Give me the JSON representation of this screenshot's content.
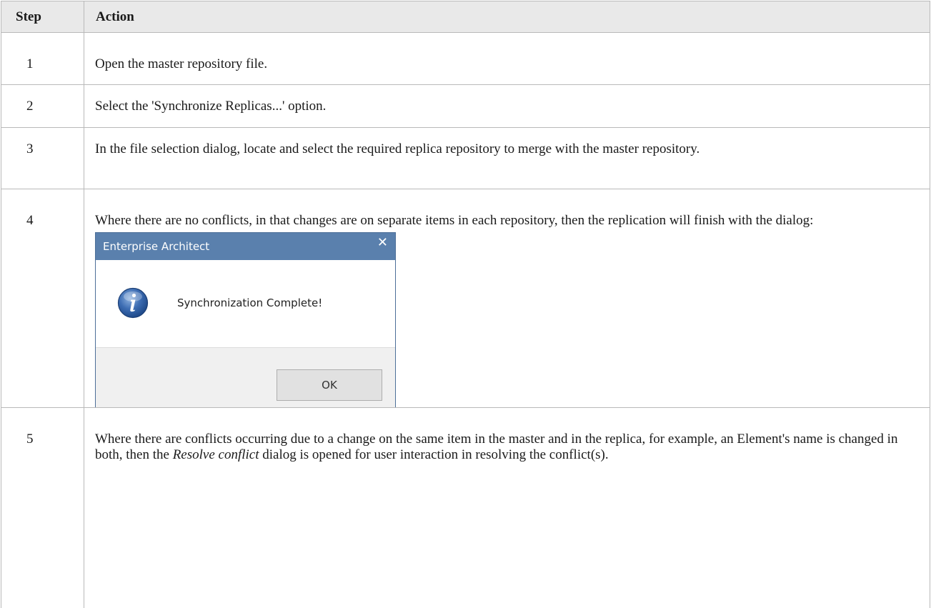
{
  "table": {
    "headers": {
      "step": "Step",
      "action": "Action"
    },
    "rows": [
      {
        "step": "1",
        "action": "Open the master repository file."
      },
      {
        "step": "2",
        "action": "Select the 'Synchronize Replicas...' option."
      },
      {
        "step": "3",
        "action": "In the file selection dialog, locate and select the required replica repository to merge with the master repository."
      },
      {
        "step": "4",
        "action": "Where there are no conflicts, in that changes are on separate items in each repository, then the replication will finish with the dialog:"
      },
      {
        "step": "5",
        "action_before": "Where there are conflicts occurring due to a change on the same item in the master and in the replica, for example, an Element's name is changed in both, then the ",
        "action_emphasis": "Resolve conflict",
        "action_after": " dialog is opened for user interaction in resolving the conflict(s)."
      }
    ]
  },
  "dialog": {
    "title": "Enterprise Architect",
    "close_glyph": "✕",
    "icon": "info-icon",
    "message": "Synchronization Complete!",
    "ok_label": "OK"
  }
}
